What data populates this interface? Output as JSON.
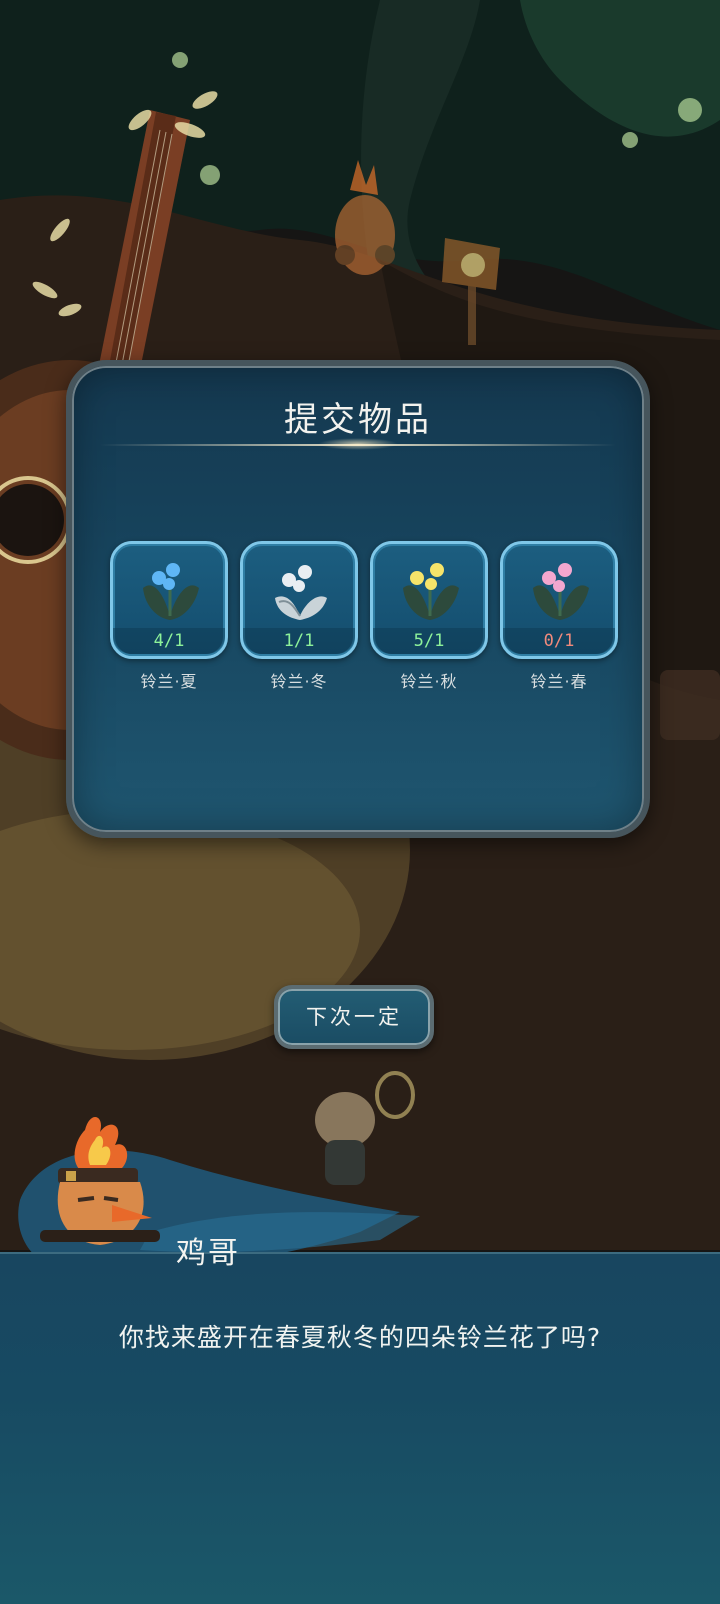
{
  "dialog": {
    "title": "提交物品",
    "items": [
      {
        "name": "铃兰·夏",
        "count": "4/1",
        "count_color": "#8df29a",
        "flower_color": "#5fb6f5",
        "icon": "blue-lily-of-the-valley-icon"
      },
      {
        "name": "铃兰·冬",
        "count": "1/1",
        "count_color": "#8df29a",
        "flower_color": "#e9eef2",
        "icon": "white-lily-of-the-valley-icon"
      },
      {
        "name": "铃兰·秋",
        "count": "5/1",
        "count_color": "#8df29a",
        "flower_color": "#f6e46a",
        "icon": "yellow-lily-of-the-valley-icon"
      },
      {
        "name": "铃兰·春",
        "count": "0/1",
        "count_color": "#f08a7c",
        "flower_color": "#f3a7cf",
        "icon": "pink-lily-of-the-valley-icon"
      }
    ]
  },
  "later_button": {
    "label": "下次一定"
  },
  "dialogue": {
    "speaker": "鸡哥",
    "text": "你找来盛开在春夏秋冬的四朵铃兰花了吗?"
  },
  "colors": {
    "panel": "#184660",
    "accent_border": "#7fc7e8",
    "count_met": "#8df29a",
    "count_unmet": "#f08a7c"
  }
}
